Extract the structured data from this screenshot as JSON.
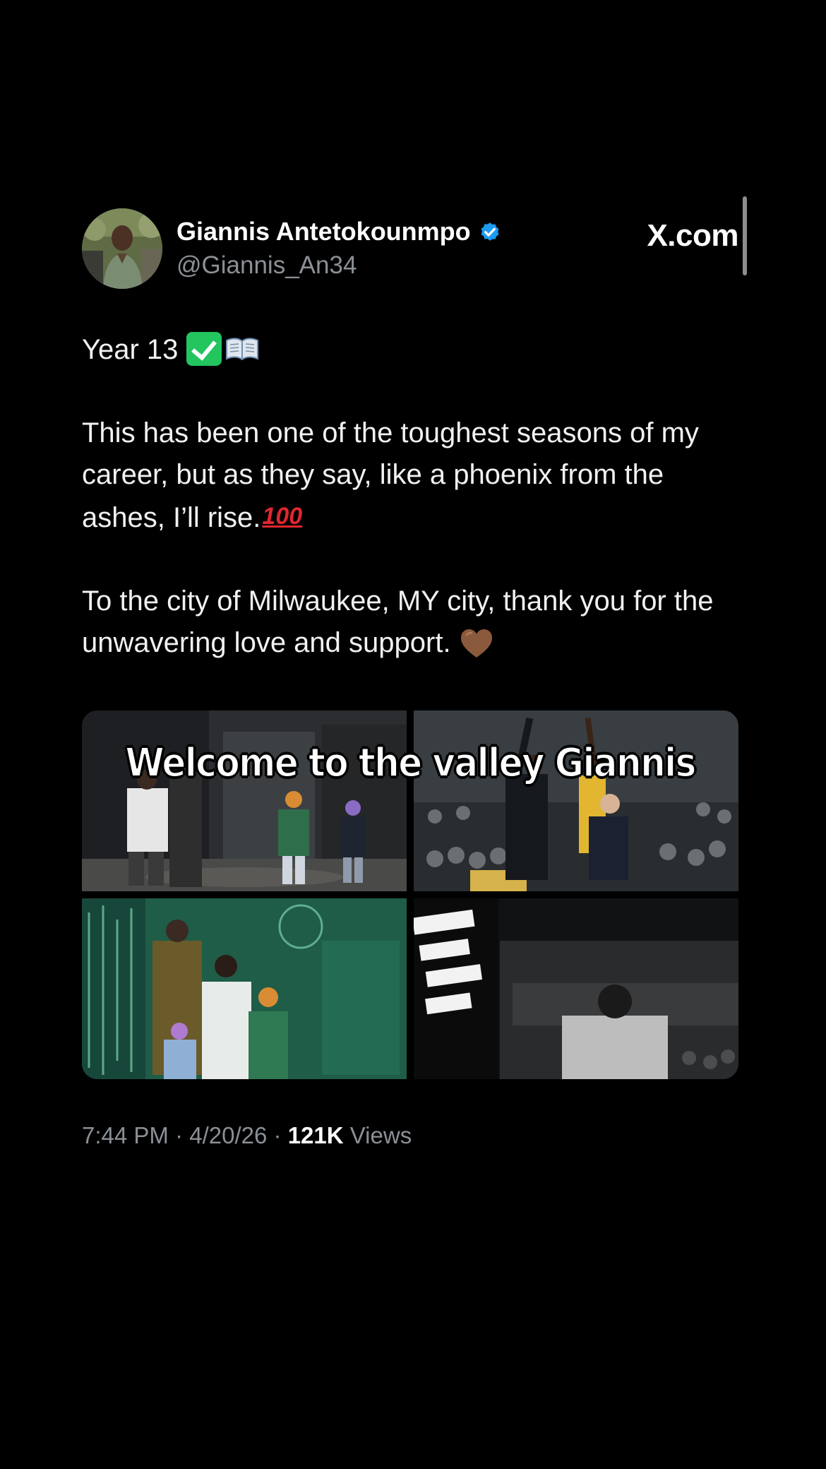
{
  "brand": {
    "label": "X.com"
  },
  "author": {
    "display_name": "Giannis Antetokounmpo",
    "handle": "@Giannis_An34",
    "verified": true,
    "verified_color": "#1d9bf0"
  },
  "post": {
    "paragraphs": [
      {
        "text": "Year 13",
        "emoji": [
          "check-mark-emoji",
          "open-book-emoji"
        ]
      },
      {
        "text": "This has been one of the toughest seasons of my career, but as they say, like a phoenix from the ashes, I’ll rise.",
        "emoji": [
          "hundred-points-emoji"
        ]
      },
      {
        "text": "To the city of Milwaukee, MY city, thank you for the unwavering love and support.",
        "emoji": [
          "brown-heart-emoji"
        ]
      }
    ],
    "hundred_glyph": "100"
  },
  "media": {
    "overlay_caption": "Welcome to the valley Giannis",
    "image_count": 4
  },
  "meta": {
    "time": "7:44 PM",
    "separator": "·",
    "date": "4/20/26",
    "views_count": "121K",
    "views_label": "Views"
  },
  "colors": {
    "background": "#000000",
    "text_primary": "#e7e9ea",
    "text_secondary": "#8b9096",
    "accent": "#1d9bf0"
  }
}
